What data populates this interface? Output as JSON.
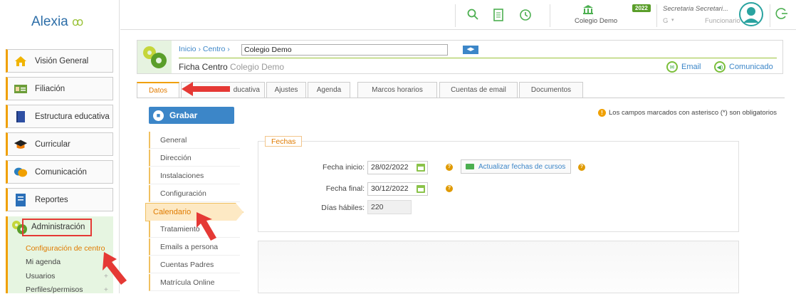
{
  "app": {
    "logo": "Alexia",
    "logo_mark": "ꝏ"
  },
  "sidebar": {
    "items": [
      {
        "label": "Visión General",
        "icon": "home-icon"
      },
      {
        "label": "Filiación",
        "icon": "id-card-icon"
      },
      {
        "label": "Estructura educativa",
        "icon": "book-icon"
      },
      {
        "label": "Curricular",
        "icon": "graduation-cap-icon"
      },
      {
        "label": "Comunicación",
        "icon": "chat-icon"
      },
      {
        "label": "Reportes",
        "icon": "report-icon"
      }
    ],
    "admin": {
      "label": "Administración",
      "subitems": [
        "Configuración de centro",
        "Mi agenda",
        "Usuarios",
        "Perfiles/permisos"
      ]
    }
  },
  "topbar": {
    "school": "Colegio Demo",
    "year": "2022",
    "user_name": "Secretaria Secretari...",
    "user_role": "Funcionario",
    "user_prefix": "G"
  },
  "header": {
    "crumb_home": "Inicio",
    "crumb_center": "Centro",
    "crumb_value": "Colegio Demo",
    "title": "Ficha Centro",
    "subtitle": "Colegio Demo",
    "email_label": "Email",
    "comunicado_label": "Comunicado"
  },
  "tabs": [
    "Datos",
    "Estructura educativa",
    "Ajustes",
    "Agenda",
    "Marcos horarios",
    "Cuentas de email",
    "Documentos"
  ],
  "tab_visible_partial": "ducativa",
  "toolbar": {
    "save_label": "Grabar",
    "required_note": "Los campos marcados con asterisco (*) son obligatorios"
  },
  "subnav": [
    "General",
    "Dirección",
    "Instalaciones",
    "Configuración",
    "Calendario",
    "Tratamiento",
    "Emails a persona",
    "Cuentas Padres",
    "Matrícula Online"
  ],
  "fechas": {
    "legend": "Fechas",
    "start_label": "Fecha inicio:",
    "start_value": "28/02/2022",
    "end_label": "Fecha final:",
    "end_value": "30/12/2022",
    "days_label": "Días hábiles:",
    "days_value": "220",
    "update_button": "Actualizar fechas de cursos"
  },
  "colors": {
    "accent": "#3c86c8",
    "orange": "#f0a000",
    "green": "#4caf50",
    "annotation": "#e53935"
  }
}
